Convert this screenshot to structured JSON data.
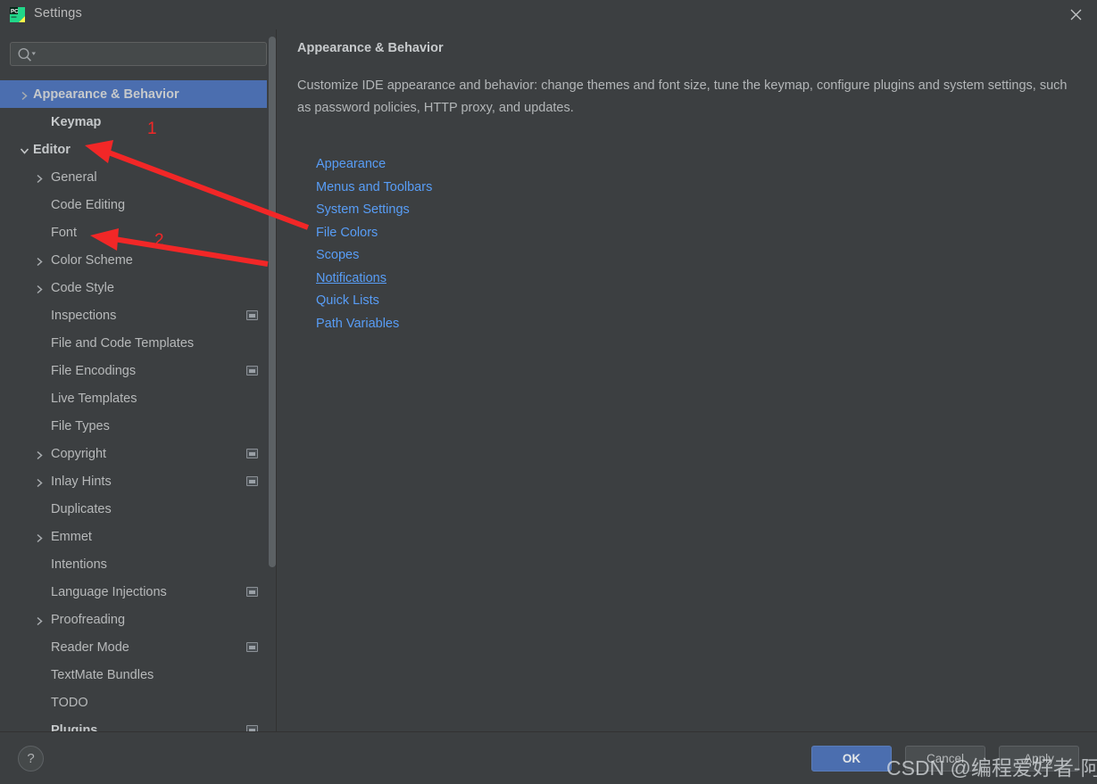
{
  "window": {
    "title": "Settings",
    "logo_icon": "pycharm-logo",
    "close_icon": "close-icon"
  },
  "search": {
    "value": "",
    "placeholder": "",
    "icon": "search-icon"
  },
  "sidebar": {
    "scrollbar": "vertical-scrollbar",
    "items": [
      {
        "label": "Appearance & Behavior",
        "indent": 0,
        "chevron": "chevron-right-icon",
        "selected": true,
        "bold": true,
        "badge": false
      },
      {
        "label": "Keymap",
        "indent": 1,
        "chevron": "",
        "selected": false,
        "bold": true,
        "badge": false
      },
      {
        "label": "Editor",
        "indent": 0,
        "chevron": "chevron-down-icon",
        "selected": false,
        "bold": true,
        "badge": false
      },
      {
        "label": "General",
        "indent": 1,
        "chevron": "chevron-right-icon",
        "selected": false,
        "bold": false,
        "badge": false
      },
      {
        "label": "Code Editing",
        "indent": 2,
        "chevron": "",
        "selected": false,
        "bold": false,
        "badge": false
      },
      {
        "label": "Font",
        "indent": 2,
        "chevron": "",
        "selected": false,
        "bold": false,
        "badge": false
      },
      {
        "label": "Color Scheme",
        "indent": 1,
        "chevron": "chevron-right-icon",
        "selected": false,
        "bold": false,
        "badge": false
      },
      {
        "label": "Code Style",
        "indent": 1,
        "chevron": "chevron-right-icon",
        "selected": false,
        "bold": false,
        "badge": false
      },
      {
        "label": "Inspections",
        "indent": 2,
        "chevron": "",
        "selected": false,
        "bold": false,
        "badge": true
      },
      {
        "label": "File and Code Templates",
        "indent": 2,
        "chevron": "",
        "selected": false,
        "bold": false,
        "badge": false
      },
      {
        "label": "File Encodings",
        "indent": 2,
        "chevron": "",
        "selected": false,
        "bold": false,
        "badge": true
      },
      {
        "label": "Live Templates",
        "indent": 2,
        "chevron": "",
        "selected": false,
        "bold": false,
        "badge": false
      },
      {
        "label": "File Types",
        "indent": 2,
        "chevron": "",
        "selected": false,
        "bold": false,
        "badge": false
      },
      {
        "label": "Copyright",
        "indent": 1,
        "chevron": "chevron-right-icon",
        "selected": false,
        "bold": false,
        "badge": true
      },
      {
        "label": "Inlay Hints",
        "indent": 1,
        "chevron": "chevron-right-icon",
        "selected": false,
        "bold": false,
        "badge": true
      },
      {
        "label": "Duplicates",
        "indent": 2,
        "chevron": "",
        "selected": false,
        "bold": false,
        "badge": false
      },
      {
        "label": "Emmet",
        "indent": 1,
        "chevron": "chevron-right-icon",
        "selected": false,
        "bold": false,
        "badge": false
      },
      {
        "label": "Intentions",
        "indent": 2,
        "chevron": "",
        "selected": false,
        "bold": false,
        "badge": false
      },
      {
        "label": "Language Injections",
        "indent": 2,
        "chevron": "",
        "selected": false,
        "bold": false,
        "badge": true
      },
      {
        "label": "Proofreading",
        "indent": 1,
        "chevron": "chevron-right-icon",
        "selected": false,
        "bold": false,
        "badge": false
      },
      {
        "label": "Reader Mode",
        "indent": 2,
        "chevron": "",
        "selected": false,
        "bold": false,
        "badge": true
      },
      {
        "label": "TextMate Bundles",
        "indent": 2,
        "chevron": "",
        "selected": false,
        "bold": false,
        "badge": false
      },
      {
        "label": "TODO",
        "indent": 2,
        "chevron": "",
        "selected": false,
        "bold": false,
        "badge": false
      },
      {
        "label": "Plugins",
        "indent": 1,
        "chevron": "",
        "selected": false,
        "bold": true,
        "badge": true
      }
    ]
  },
  "main": {
    "title": "Appearance & Behavior",
    "description": "Customize IDE appearance and behavior: change themes and font size, tune the keymap, configure plugins and system settings, such as password policies, HTTP proxy, and updates.",
    "links": [
      {
        "label": "Appearance",
        "hovered": false
      },
      {
        "label": "Menus and Toolbars",
        "hovered": false
      },
      {
        "label": "System Settings",
        "hovered": false
      },
      {
        "label": "File Colors",
        "hovered": false
      },
      {
        "label": "Scopes",
        "hovered": false
      },
      {
        "label": "Notifications",
        "hovered": true
      },
      {
        "label": "Quick Lists",
        "hovered": false
      },
      {
        "label": "Path Variables",
        "hovered": false
      }
    ]
  },
  "footer": {
    "help_label": "?",
    "help_icon": "help-icon",
    "ok_label": "OK",
    "cancel_label": "Cancel",
    "apply_label": "Apply"
  },
  "annotations": {
    "color": "#f22727",
    "marks": [
      {
        "number": "1",
        "target": "Editor"
      },
      {
        "number": "2",
        "target": "Font"
      }
    ]
  },
  "watermark": {
    "text": "CSDN @编程爱好者-阿新"
  },
  "colors": {
    "background": "#3c3f41",
    "selection": "#4b6eaf",
    "link": "#589df6",
    "text": "#b7b9ba",
    "accent_red": "#f22727"
  }
}
